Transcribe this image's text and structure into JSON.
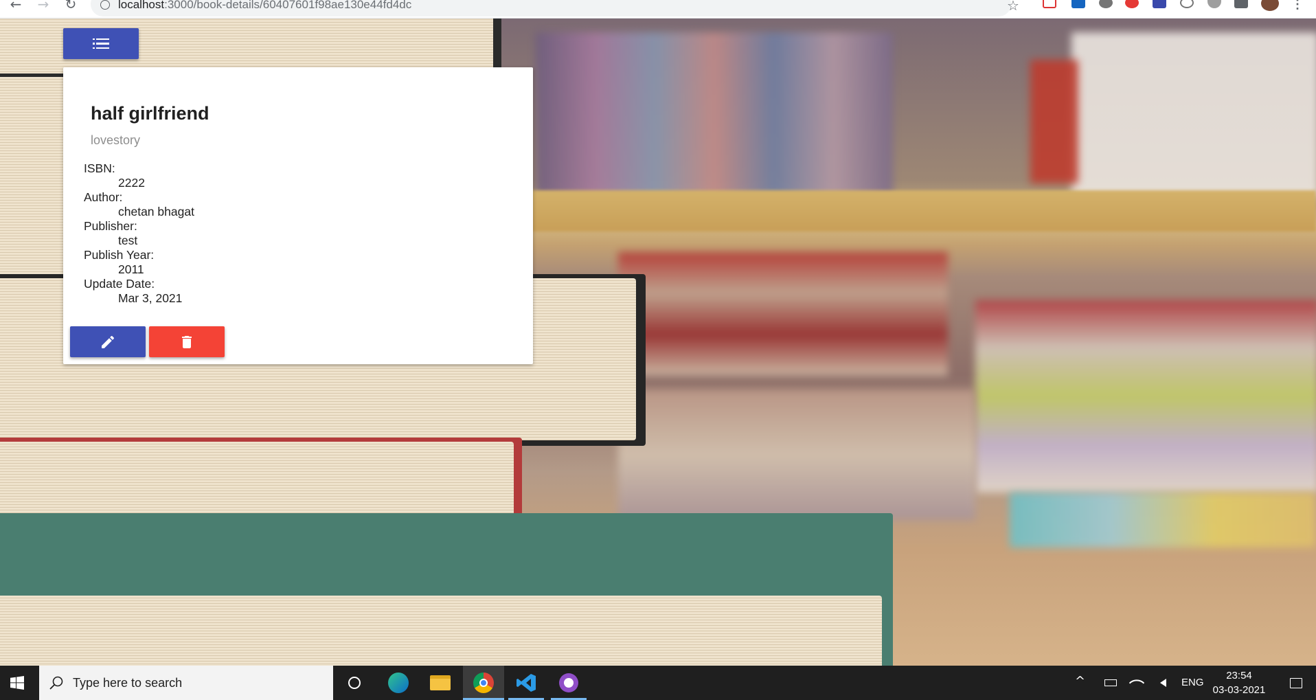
{
  "browser": {
    "url_host": "localhost",
    "url_path": ":3000/book-details/60407601f98ae130e44fd4dc"
  },
  "book": {
    "title": "half girlfriend",
    "genre": "lovestory",
    "fields": [
      {
        "label": "ISBN:",
        "value": "2222"
      },
      {
        "label": "Author:",
        "value": "chetan bhagat"
      },
      {
        "label": "Publisher:",
        "value": "test"
      },
      {
        "label": "Publish Year:",
        "value": "2011"
      },
      {
        "label": "Update Date:",
        "value": "Mar 3, 2021"
      }
    ]
  },
  "icons": {
    "menu": "list-icon",
    "edit": "pencil-icon",
    "delete": "trash-icon"
  },
  "colors": {
    "primary": "#3f51b5",
    "danger": "#f44336",
    "taskbar": "#1f1f1f"
  },
  "taskbar": {
    "search_placeholder": "Type here to search",
    "language": "ENG",
    "time": "23:54",
    "date": "03-03-2021"
  }
}
